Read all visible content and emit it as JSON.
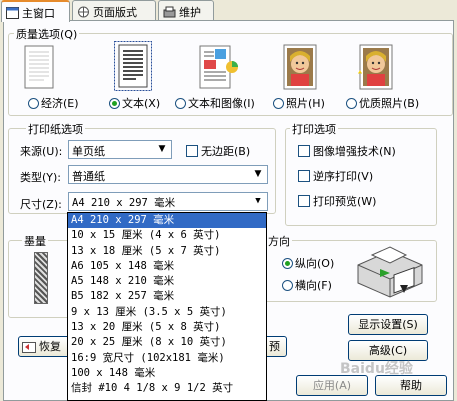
{
  "tabs": [
    {
      "label": "主窗口",
      "icon": "main-window-icon"
    },
    {
      "label": "页面版式",
      "icon": "page-layout-icon"
    },
    {
      "label": "维护",
      "icon": "maintenance-icon"
    }
  ],
  "quality": {
    "title": "质量选项(Q)",
    "options": [
      {
        "label": "经济(E)",
        "icon": "economy-document-icon",
        "selected": false
      },
      {
        "label": "文本(X)",
        "icon": "text-document-icon",
        "selected": true
      },
      {
        "label": "文本和图像(I)",
        "icon": "text-image-document-icon",
        "selected": false
      },
      {
        "label": "照片(H)",
        "icon": "photo-icon",
        "selected": false
      },
      {
        "label": "优质照片(B)",
        "icon": "best-photo-icon",
        "selected": false
      }
    ]
  },
  "paper": {
    "title": "打印纸选项",
    "source_label": "来源(U):",
    "source_value": "单页纸",
    "borderless_label": "无边距(B)",
    "type_label": "类型(Y):",
    "type_value": "普通纸",
    "size_label": "尺寸(Z):",
    "size_value": "A4 210 x 297 毫米",
    "size_options": [
      "A4 210 x 297 毫米",
      "10 x 15 厘米 (4 x 6 英寸)",
      "13 x 18 厘米 (5 x 7 英寸)",
      "A6 105 x 148 毫米",
      "A5 148 x 210 毫米",
      "B5 182 x 257 毫米",
      "9 x 13 厘米 (3.5 x 5 英寸)",
      "13 x 20 厘米 (5 x 8 英寸)",
      "20 x 25 厘米 (8 x 10 英寸)",
      "16:9 宽尺寸 (102x181 毫米)",
      "100 x 148 毫米",
      "信封 #10 4 1/8 x 9 1/2 英寸"
    ]
  },
  "print_options": {
    "title": "打印选项",
    "items": [
      {
        "label": "图像增强技术(N)"
      },
      {
        "label": "逆序打印(V)"
      },
      {
        "label": "打印预览(W)"
      }
    ]
  },
  "ink": {
    "title": "墨量"
  },
  "orientation": {
    "partial_title": "方向",
    "portrait": "纵向(O)",
    "landscape": "横向(F)"
  },
  "buttons": {
    "display_settings": "显示设置(S)",
    "advanced": "高级(C)",
    "restore_partial": "恢复",
    "hidden_partial": "预",
    "apply": "应用(A)",
    "help": "帮助"
  },
  "watermark": "Baidu经验"
}
